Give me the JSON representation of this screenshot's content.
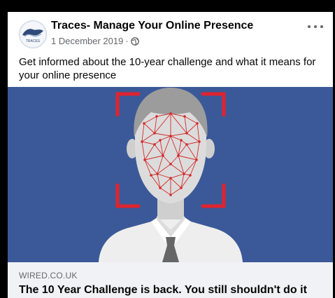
{
  "post": {
    "page_name": "Traces- Manage Your Online Presence",
    "date": "1 December 2019",
    "separator": "·",
    "privacy_icon": "globe-icon",
    "more_icon": "more-options-icon",
    "text": "Get informed about the 10-year challenge and what it means for your online presence",
    "avatar_text": "TRACES"
  },
  "link_preview": {
    "domain": "WIRED.CO.UK",
    "title": "The 10 Year Challenge is back. You still shouldn't do it"
  },
  "colors": {
    "image_background": "#3b5998",
    "face_mesh": "#d42a2a",
    "scan_brackets": "#e0232e"
  }
}
